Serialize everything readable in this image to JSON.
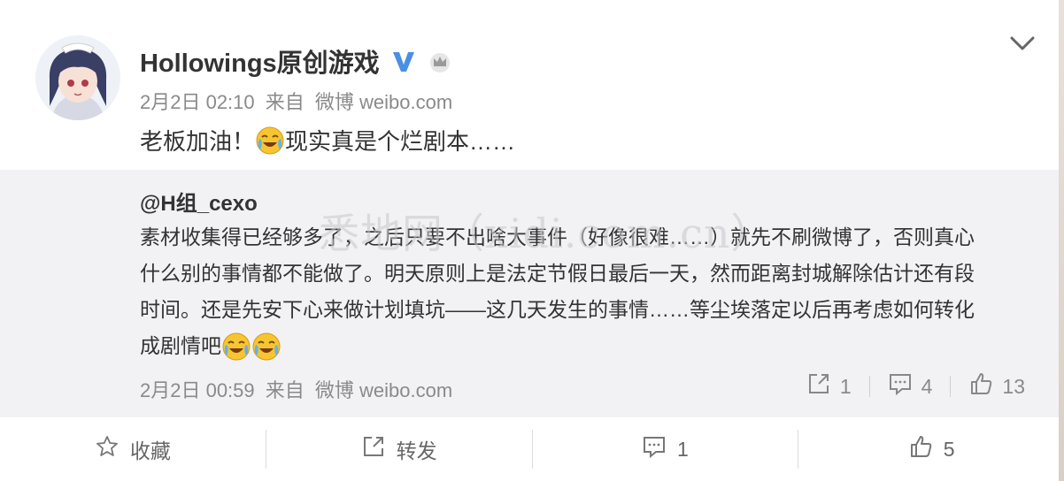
{
  "post": {
    "author": "Hollowings原创游戏",
    "meta": {
      "date": "2月2日 02:10",
      "from": "来自",
      "source": "微博 weibo.com"
    },
    "text_part1": "老板加油！",
    "text_part2": "现实真是个烂剧本……"
  },
  "repost": {
    "author": "@H组_cexo",
    "text_line1": "素材收集得已经够多了，之后只要不出啥大事件（好像很难……）就先不刷微博了，否则真心",
    "text_line2": "什么别的事情都不能做了。明天原则上是法定节假日最后一天，然而距离封城解除估计还有段",
    "text_line3": "时间。还是先安下心来做计划填坑——这几天发生的事情……等尘埃落定以后再考虑如何转化",
    "text_line4": "成剧情吧",
    "meta": {
      "date": "2月2日 00:59",
      "from": "来自",
      "source": "微博 weibo.com"
    },
    "actions": {
      "repost_count": "1",
      "comment_count": "4",
      "like_count": "13"
    }
  },
  "watermark": "悉地网（xidi.com.cn）",
  "bottom_bar": {
    "favorite_label": "收藏",
    "repost_label": "转发",
    "comment_count": "1",
    "like_count": "5"
  },
  "icons": {
    "verified": "verified-v-icon",
    "crown": "crown-icon",
    "emoji": "laugh-cry-emoji-icon",
    "more": "chevron-down-icon",
    "star": "star-icon",
    "share": "share-icon",
    "comment": "comment-icon",
    "like": "thumbs-up-icon"
  },
  "colors": {
    "verified_blue": "#4a90e2",
    "repost_bg": "#f2f2f5",
    "muted": "#8a8a8a"
  }
}
